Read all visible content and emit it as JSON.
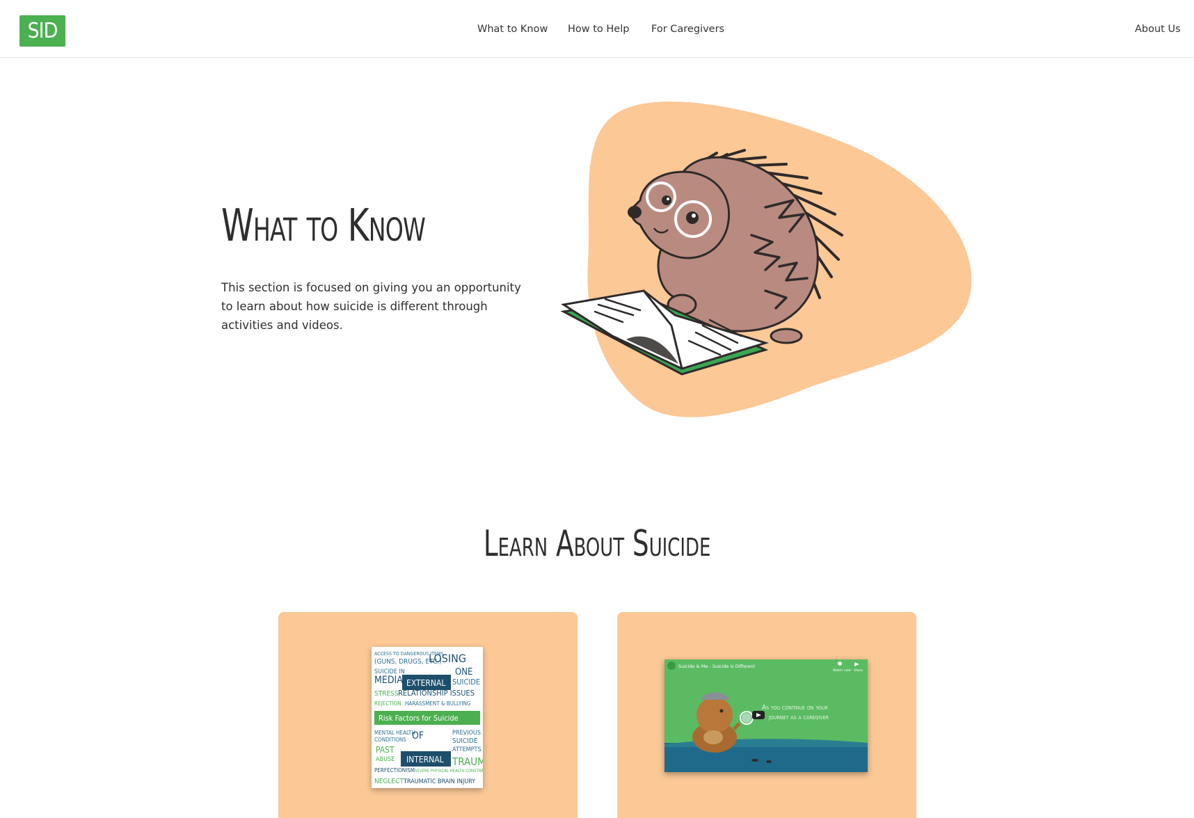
{
  "header": {
    "logo_text": "SID",
    "nav": {
      "what_to_know": "What to Know",
      "how_to_help": "How to Help",
      "for_caregivers": "For Caregivers",
      "about_us": "About Us"
    }
  },
  "hero": {
    "title": "What to Know",
    "description": "This section is focused on giving you an opportunity to learn about how suicide is different through activities and videos."
  },
  "section": {
    "title": "Learn About Suicide"
  },
  "cards": {
    "poster": {
      "banner": "Risk Factors for Suicide",
      "external_label": "EXTERNAL",
      "internal_label": "INTERNAL"
    },
    "video": {
      "title": "Suicide & Me - Suicide is Different",
      "watch_later": "Watch Later",
      "share": "Share",
      "caption_line1": "As you continue on your",
      "caption_line2": "journey as a caregiver"
    }
  },
  "colors": {
    "brand_green": "#4caf50",
    "accent_peach": "#fbc896",
    "porcupine_brown": "#b98a80",
    "text_dark": "#2e2e2e"
  }
}
